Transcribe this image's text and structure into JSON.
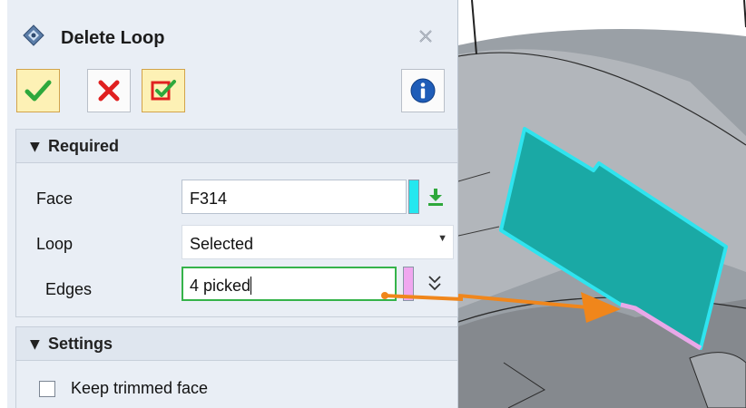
{
  "dialog": {
    "title": "Delete Loop",
    "icon": "delete-loop-icon",
    "close_icon": "close-icon",
    "toolbar": [
      {
        "name": "ok",
        "icon": "check-icon",
        "color": "#2ea83c"
      },
      {
        "name": "cancel",
        "icon": "x-icon",
        "color": "#e02020"
      },
      {
        "name": "apply",
        "icon": "apply-check-icon",
        "color": "#e02020"
      },
      {
        "name": "info",
        "icon": "info-icon",
        "color": "#1f5db8"
      }
    ]
  },
  "required": {
    "header": "Required",
    "face": {
      "label": "Face",
      "value": "F314",
      "swatch_color": "#25e7ef"
    },
    "loop": {
      "label": "Loop",
      "value": "Selected"
    },
    "edges": {
      "label": "Edges",
      "value": "4 picked",
      "swatch_color": "#f0a7ef"
    }
  },
  "settings": {
    "header": "Settings",
    "keep_trimmed": {
      "label": "Keep trimmed face",
      "checked": false
    }
  },
  "colors": {
    "accent_green": "#35b34a",
    "face_fill": "#1aa9a5",
    "face_outline": "#2fe4ef",
    "selected_edges": "#e9a8e8",
    "arrow": "#f0861b"
  }
}
